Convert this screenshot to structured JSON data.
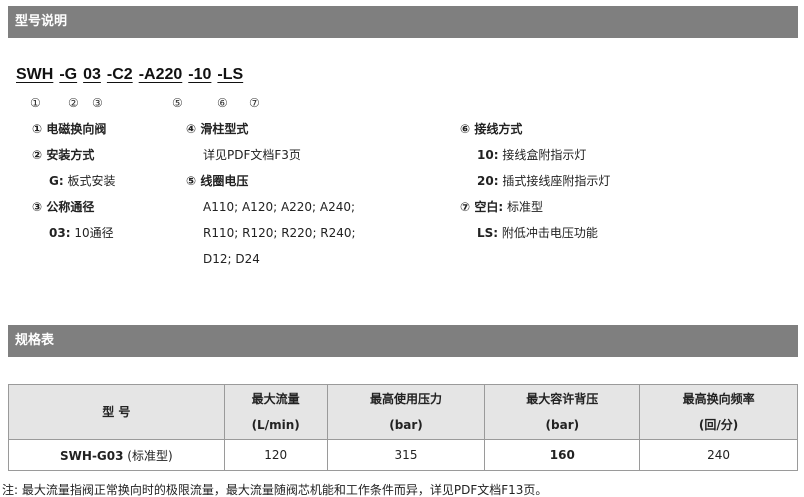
{
  "section1": {
    "title": "型号说明"
  },
  "model": {
    "parts": [
      "SWH",
      "-G",
      "03",
      "-C2",
      "-A220",
      "-10",
      "-LS"
    ]
  },
  "markers": [
    "①",
    "②",
    "③",
    "⑤",
    "⑥",
    "⑦"
  ],
  "col1": {
    "item1_label": "① 电磁换向阀",
    "item2_label": "② 安装方式",
    "item2_key": "G:",
    "item2_val": "板式安装",
    "item3_label": "③ 公称通径",
    "item3_key": "03:",
    "item3_val": "10通径"
  },
  "col2": {
    "item4_label": "④ 滑柱型式",
    "item4_text": "详见PDF文档F3页",
    "item5_label": "⑤ 线圈电压",
    "item5_line1": "A110; A120; A220; A240;",
    "item5_line2": "R110; R120; R220; R240;",
    "item5_line3": "D12; D24"
  },
  "col3": {
    "item6_label": "⑥ 接线方式",
    "item6_opt1_key": "10:",
    "item6_opt1_val": "接线盒附指示灯",
    "item6_opt2_key": "20:",
    "item6_opt2_val": "插式接线座附指示灯",
    "item7_label": "⑦ 空白:",
    "item7_val": "标准型",
    "item7_opt_key": "LS:",
    "item7_opt_val": "附低冲击电压功能"
  },
  "section2": {
    "title": "规格表"
  },
  "table": {
    "headers": [
      {
        "line1": "型 号",
        "line2": ""
      },
      {
        "line1": "最大流量",
        "line2": "(L/min)"
      },
      {
        "line1": "最高使用压力",
        "line2": "(bar)"
      },
      {
        "line1": "最大容许背压",
        "line2": "(bar)"
      },
      {
        "line1": "最高换向频率",
        "line2": "(回/分)"
      }
    ],
    "row": {
      "model": "SWH-G03",
      "model_note": "(标准型)",
      "flow": "120",
      "pressure": "315",
      "back_pressure": "160",
      "frequency": "240"
    }
  },
  "note": "注: 最大流量指阀正常换向时的极限流量，最大流量随阀芯机能和工作条件而异，详见PDF文档F13页。"
}
